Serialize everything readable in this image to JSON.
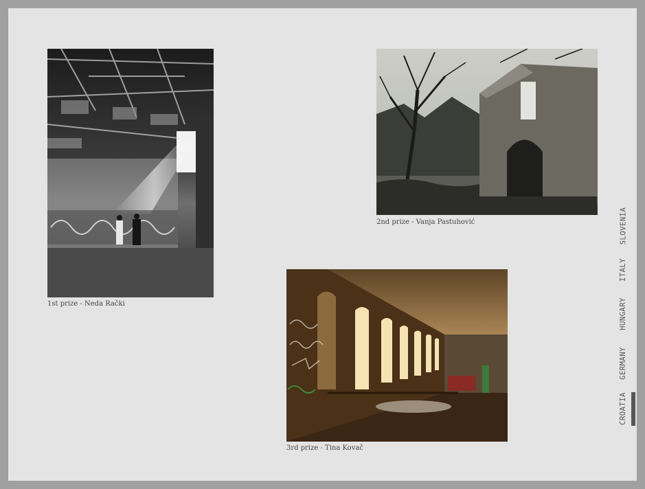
{
  "gallery": {
    "photos": [
      {
        "caption": "1st prize - Neda Rački",
        "image_icon": "abandoned-hall-photo"
      },
      {
        "caption": "2nd prize - Vanja Pastuhović",
        "image_icon": "ruined-church-photo"
      },
      {
        "caption": "3rd prize - Tina Kovač",
        "image_icon": "arched-corridor-photo"
      }
    ]
  },
  "country_tabs": {
    "items": [
      "SLOVENIA",
      "ITALY",
      "HUNGARY",
      "GERMANY",
      "CROATIA"
    ],
    "active": "CROATIA",
    "active_color": "#555555"
  },
  "colors": {
    "frame": "#a0a0a0",
    "panel": "#e4e4e4"
  }
}
